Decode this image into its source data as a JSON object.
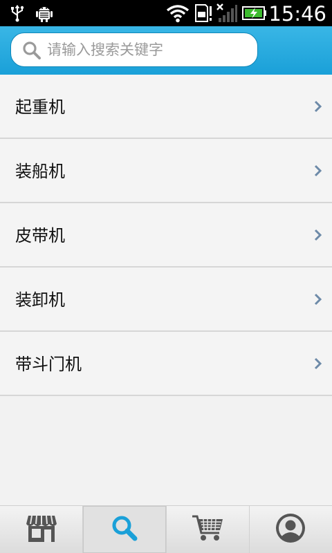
{
  "status_bar": {
    "time": "15:46",
    "icons": [
      "usb-icon",
      "android-debug-icon",
      "wifi-icon",
      "sd-card-icon",
      "signal-icon",
      "battery-charging-icon"
    ]
  },
  "search": {
    "placeholder": "请输入搜索关键字",
    "value": ""
  },
  "list": {
    "items": [
      {
        "label": "起重机"
      },
      {
        "label": "装船机"
      },
      {
        "label": "皮带机"
      },
      {
        "label": "装卸机"
      },
      {
        "label": "带斗门机"
      }
    ]
  },
  "tab_bar": {
    "tabs": [
      {
        "icon": "store-icon",
        "active": false
      },
      {
        "icon": "search-icon",
        "active": true
      },
      {
        "icon": "cart-icon",
        "active": false
      },
      {
        "icon": "user-profile-icon",
        "active": false
      }
    ]
  },
  "colors": {
    "header_blue": "#1aa0d8",
    "active_tab_icon": "#1aa0d8",
    "inactive_tab_icon": "#555555"
  }
}
